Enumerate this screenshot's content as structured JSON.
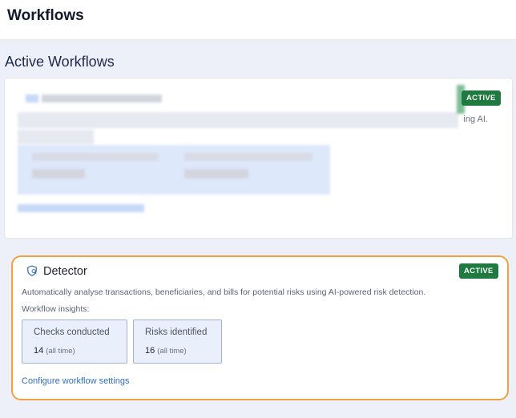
{
  "header": {
    "title": "Workflows"
  },
  "section": {
    "title": "Active Workflows"
  },
  "blurred_workflow": {
    "badge": "ACTIVE",
    "trailing_text": "ing AI."
  },
  "detector": {
    "title": "Detector",
    "badge": "ACTIVE",
    "description": "Automatically analyse transactions, beneficiaries, and bills for potential risks using AI-powered risk detection.",
    "insights_label": "Workflow insights:",
    "stats": [
      {
        "label": "Checks conducted",
        "value": "14",
        "suffix": "(all time)"
      },
      {
        "label": "Risks identified",
        "value": "16",
        "suffix": "(all time)"
      }
    ],
    "link": "Configure workflow settings"
  },
  "colors": {
    "badge": "#1e7a3f",
    "highlight_border": "#f2a040",
    "link": "#2f6fcf"
  }
}
